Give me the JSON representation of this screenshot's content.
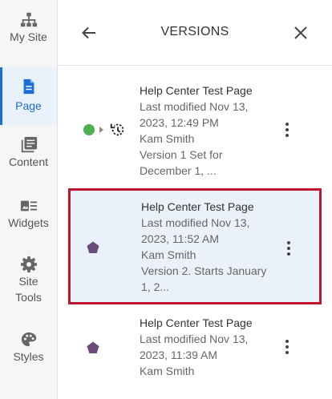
{
  "rail": {
    "items": [
      {
        "label": "My Site",
        "icon": "sitemap-icon"
      },
      {
        "label": "Page",
        "icon": "page-icon"
      },
      {
        "label": "Content",
        "icon": "content-library-icon"
      },
      {
        "label": "Widgets",
        "icon": "widgets-icon"
      },
      {
        "label": "Site Tools",
        "label_line1": "Site",
        "label_line2": "Tools",
        "icon": "gear-icon"
      },
      {
        "label": "Styles",
        "icon": "palette-icon"
      }
    ],
    "active": "Page"
  },
  "header": {
    "title": "VERSIONS",
    "back_icon": "arrow-left-icon",
    "close_icon": "close-icon"
  },
  "versions": [
    {
      "title": "Help Center Test Page",
      "modified_line1": "Last modified Nov 13,",
      "modified_line2": "2023, 12:49 PM",
      "author": "Kam Smith",
      "note_line1": "Version 1 Set for",
      "note_line2": "December 1, ...",
      "status": "live-scheduled",
      "status_color": "#4caf50"
    },
    {
      "title": "Help Center Test Page",
      "modified_line1": "Last modified Nov 13,",
      "modified_line2": "2023, 11:52 AM",
      "author": "Kam Smith",
      "note_line1": "Version 2. Starts January",
      "note_line2": "1, 2...",
      "status": "draft",
      "status_color": "#6b4c7a",
      "selected": true
    },
    {
      "title": "Help Center Test Page",
      "modified_line1": "Last modified Nov 13,",
      "modified_line2": "2023, 11:39 AM",
      "author": "Kam Smith",
      "status": "draft",
      "status_color": "#6b4c7a"
    }
  ],
  "colors": {
    "accent": "#1a6fd6",
    "selection_border": "#c0162c",
    "selection_bg": "#eaf1fb"
  }
}
